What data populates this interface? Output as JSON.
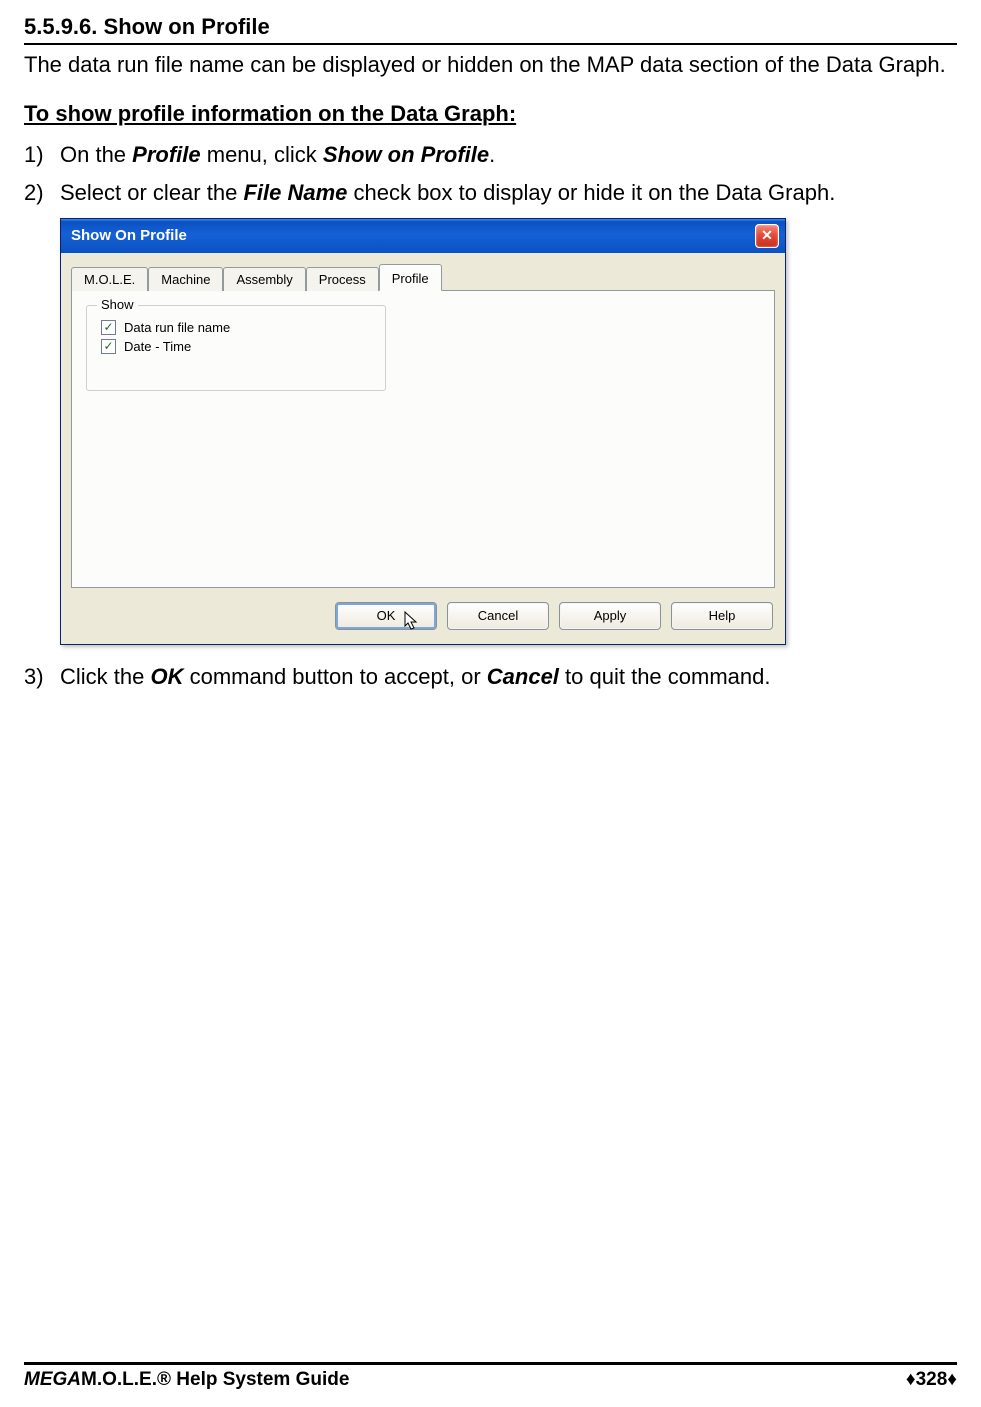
{
  "section": {
    "number": "5.5.9.6.",
    "title": "Show on Profile",
    "intro": "The data run file name can be displayed or hidden on the MAP data section of the Data Graph.",
    "sub_heading": "To show profile information on the Data Graph:",
    "steps": {
      "s1": {
        "num": "1)",
        "pre": "On the ",
        "m1": "Profile",
        "mid": " menu, click ",
        "m2": "Show on Profile",
        "post": "."
      },
      "s2": {
        "num": "2)",
        "pre": "Select or clear the ",
        "m1": "File Name",
        "post": " check box to display or hide it on the Data Graph."
      },
      "s3": {
        "num": "3)",
        "pre": "Click the ",
        "m1": "OK",
        "mid": " command button to accept, or ",
        "m2": "Cancel",
        "post": " to quit the command."
      }
    }
  },
  "dialog": {
    "title": "Show On Profile",
    "close_glyph": "✕",
    "tabs": [
      "M.O.L.E.",
      "Machine",
      "Assembly",
      "Process",
      "Profile"
    ],
    "active_tab_index": 4,
    "group": {
      "legend": "Show",
      "checks": [
        {
          "label": "Data run file name",
          "checked": true
        },
        {
          "label": "Date - Time",
          "checked": true
        }
      ]
    },
    "buttons": {
      "ok": "OK",
      "cancel": "Cancel",
      "apply": "Apply",
      "help": "Help"
    }
  },
  "footer": {
    "title_mega": "MEGA",
    "title_rest": "M.O.L.E.® Help System Guide",
    "page_left_diamond": "♦",
    "page_num": "328",
    "page_right_diamond": "♦"
  }
}
